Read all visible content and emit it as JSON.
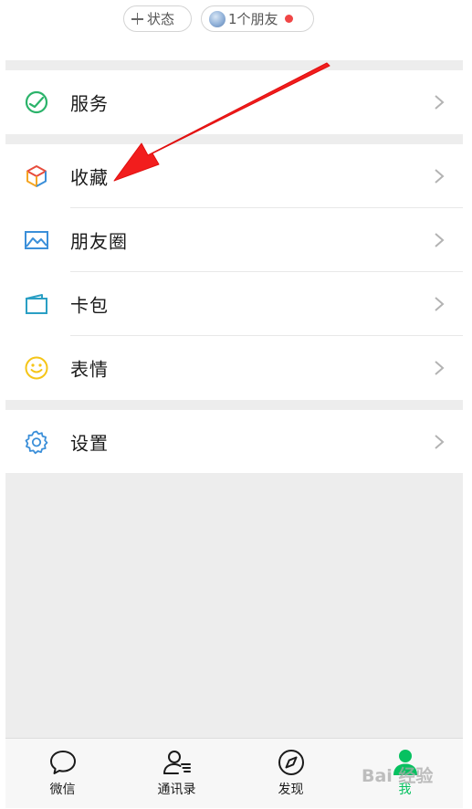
{
  "top": {
    "status_label": "状态",
    "friends_label": "1个朋友",
    "dot_color": "#f04646"
  },
  "menu": {
    "services": "服务",
    "favorites": "收藏",
    "moments": "朋友圈",
    "cards": "卡包",
    "stickers": "表情",
    "settings": "设置"
  },
  "tabs": [
    {
      "label": "微信",
      "icon": "chat-bubble-icon"
    },
    {
      "label": "通讯录",
      "icon": "contacts-icon"
    },
    {
      "label": "发现",
      "icon": "compass-icon"
    },
    {
      "label": "我",
      "icon": "me-person-icon",
      "active": true
    }
  ],
  "watermark": "Bai 经验",
  "colors": {
    "accent_green": "#07c160",
    "arrow_red": "#f21d1d"
  }
}
